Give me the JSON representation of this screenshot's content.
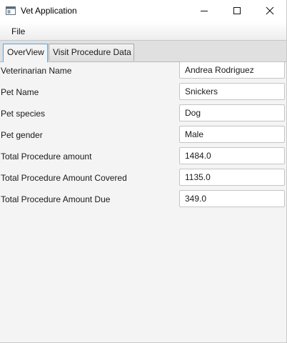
{
  "window": {
    "title": "Vet Application",
    "controls": [
      "minimize",
      "maximize",
      "close"
    ]
  },
  "menu": {
    "file_label": "File"
  },
  "tabs": [
    {
      "label": "OverView",
      "selected": true
    },
    {
      "label": "Visit Procedure Data",
      "selected": false
    }
  ],
  "overview": {
    "rows": [
      {
        "label": "Veterinarian Name",
        "value": "Andrea Rodriguez"
      },
      {
        "label": "Pet Name",
        "value": "Snickers"
      },
      {
        "label": "Pet species",
        "value": "Dog"
      },
      {
        "label": "Pet gender",
        "value": "Male"
      },
      {
        "label": "Total Procedure amount",
        "value": "1484.0"
      },
      {
        "label": "Total Procedure Amount Covered",
        "value": "1135.0"
      },
      {
        "label": "Total Procedure Amount Due",
        "value": "349.0"
      }
    ]
  }
}
